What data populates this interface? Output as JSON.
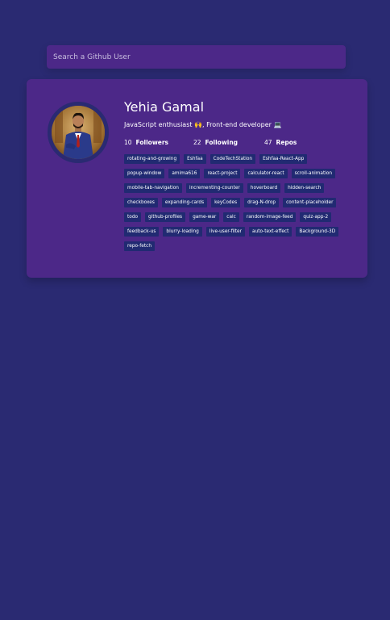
{
  "search": {
    "placeholder": "Search a Github User"
  },
  "profile": {
    "name": "Yehia Gamal",
    "bio": "JavaScript enthusiast 🙌, Front-end developer 💻",
    "followers": {
      "count": "10",
      "label": "Followers"
    },
    "following": {
      "count": "22",
      "label": "Following"
    },
    "repos_stat": {
      "count": "47",
      "label": "Repos"
    }
  },
  "repos": [
    "rotating-and-growing",
    "Eshfaa",
    "CodeTechStation",
    "Eshfaa-React-App",
    "popup-window",
    "amima616",
    "react-project",
    "calculator-react",
    "scroll-animation",
    "mobile-tab-navigation",
    "incrementing-counter",
    "hoverboard",
    "hidden-search",
    "checkboxes",
    "expanding-cards",
    "keyCodes",
    "drag-N-drop",
    "content-placeholder",
    "todo",
    "github-profiles",
    "game-war",
    "calc",
    "random-image-feed",
    "quiz-app-2",
    "feedback-us",
    "blurry-loading",
    "live-user-filter",
    "auto-text-effect",
    "Background-3D",
    "repo-fetch"
  ],
  "colors": {
    "background": "#2a2a72",
    "card": "#4c2888",
    "repo_badge": "#212a72",
    "text": "#ffffff"
  }
}
